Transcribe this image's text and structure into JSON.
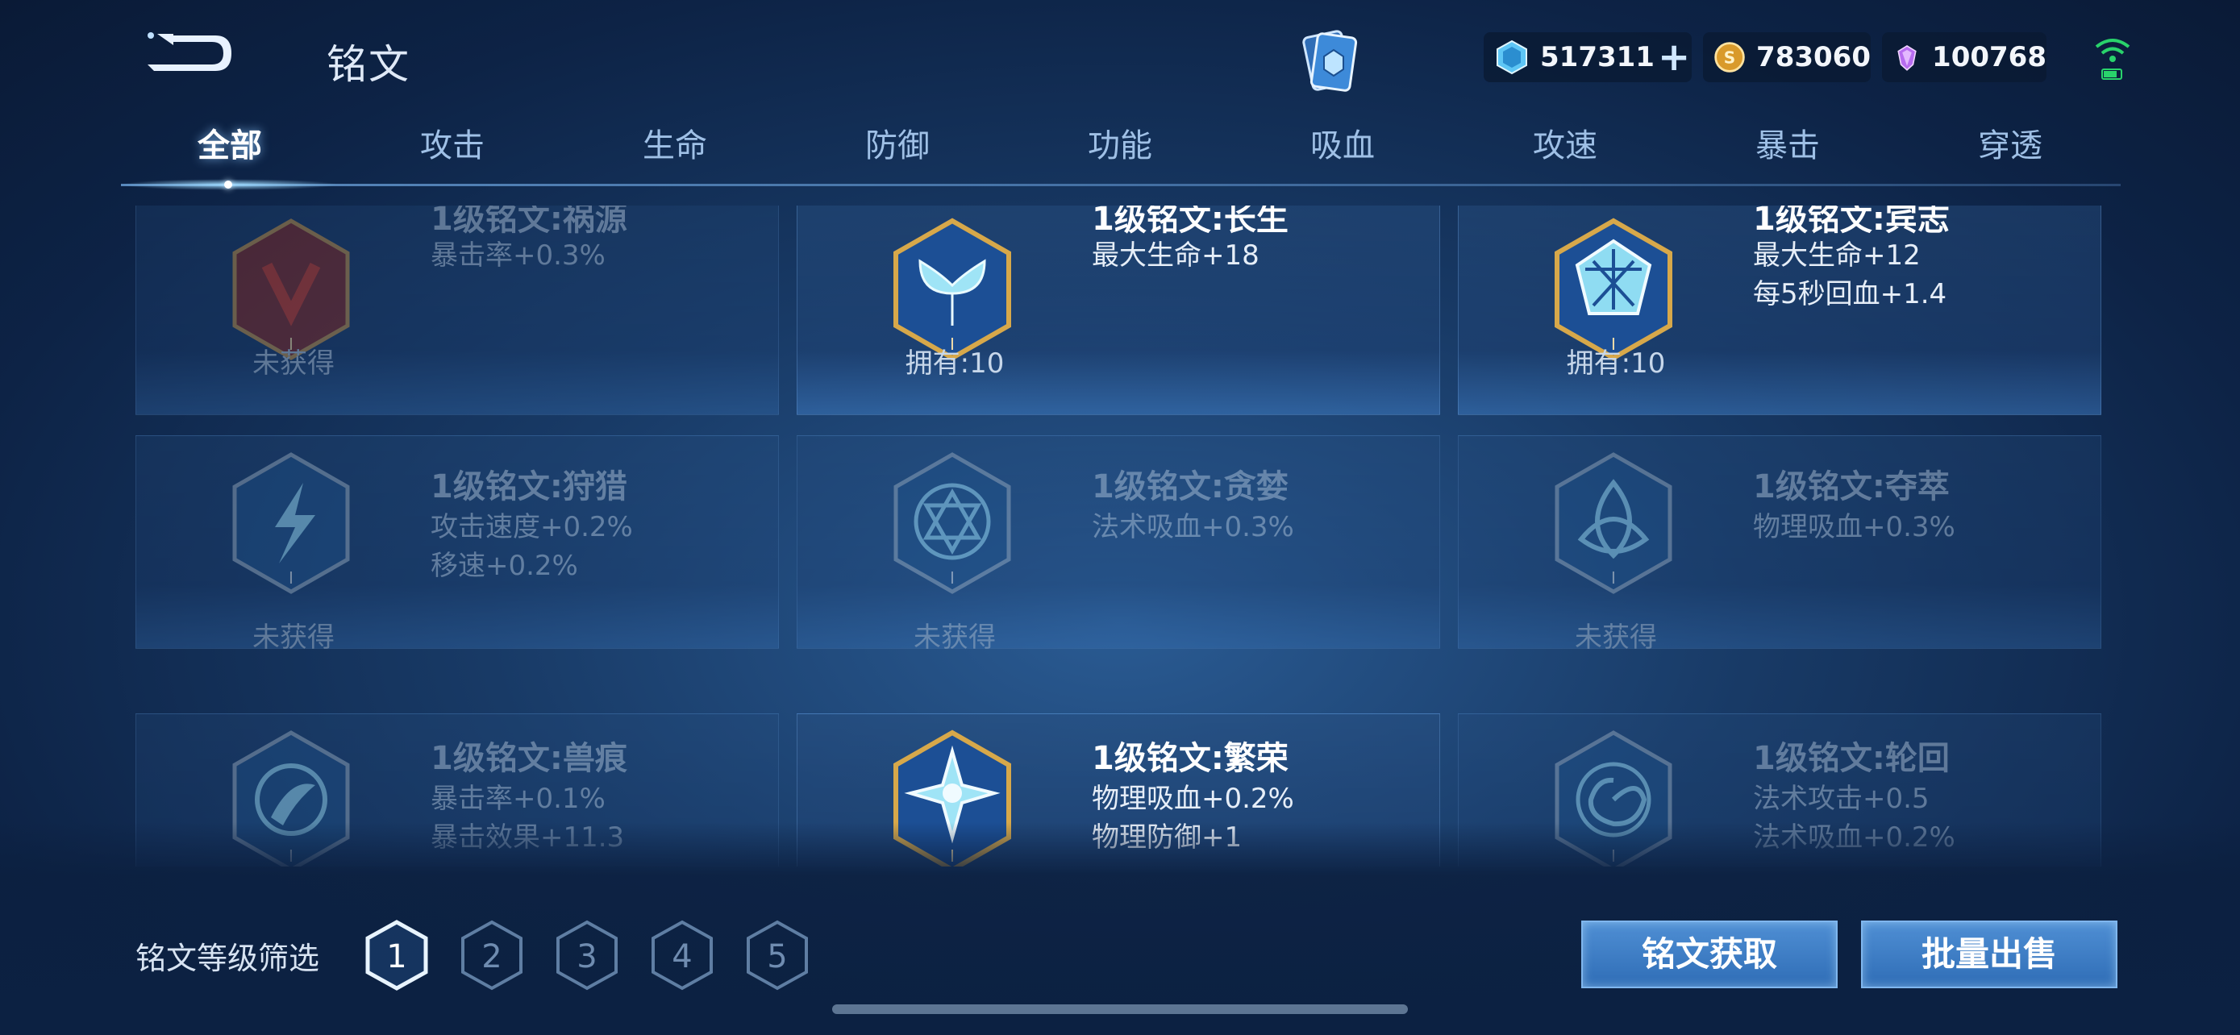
{
  "header": {
    "title": "铭文",
    "currencies": [
      {
        "icon": "diamond-gem-icon",
        "value": "517311"
      },
      {
        "icon": "gold-coin-icon",
        "value": "783060"
      },
      {
        "icon": "purple-crystal-icon",
        "value": "100768"
      }
    ]
  },
  "tabs": [
    "全部",
    "攻击",
    "生命",
    "防御",
    "功能",
    "吸血",
    "攻速",
    "暴击",
    "穿透"
  ],
  "active_tab": "全部",
  "cards": [
    {
      "name": "1级铭文:祸源",
      "lines": [
        "暴击率+0.3%",
        ""
      ],
      "status": "未获得",
      "owned": false,
      "color": "#c0392b",
      "icon": "claw-rune-icon"
    },
    {
      "name": "1级铭文:长生",
      "lines": [
        "最大生命+18",
        ""
      ],
      "status": "拥有:10",
      "owned": true,
      "color": "#3fb7e0",
      "icon": "tail-rune-icon"
    },
    {
      "name": "1级铭文:宾志",
      "lines": [
        "最大生命+12",
        "每5秒回血+1.4"
      ],
      "status": "拥有:10",
      "owned": true,
      "color": "#3fb7e0",
      "icon": "crystal-rune-icon"
    },
    {
      "name": "1级铭文:狩猎",
      "lines": [
        "攻击速度+0.2%",
        "移速+0.2%"
      ],
      "status": "未获得",
      "owned": false,
      "color": "#3a7fc0",
      "icon": "lightning-rune-icon"
    },
    {
      "name": "1级铭文:贪婪",
      "lines": [
        "法术吸血+0.3%",
        ""
      ],
      "status": "未获得",
      "owned": false,
      "color": "#3a7fc0",
      "icon": "star-rune-icon"
    },
    {
      "name": "1级铭文:夺萃",
      "lines": [
        "物理吸血+0.3%",
        ""
      ],
      "status": "未获得",
      "owned": false,
      "color": "#3a7fc0",
      "icon": "knot-rune-icon"
    },
    {
      "name": "1级铭文:兽痕",
      "lines": [
        "暴击率+0.1%",
        "暴击效果+11.3"
      ],
      "status": "",
      "owned": false,
      "color": "#3a7fc0",
      "icon": "beast-rune-icon"
    },
    {
      "name": "1级铭文:繁荣",
      "lines": [
        "物理吸血+0.2%",
        "物理防御+1"
      ],
      "status": "",
      "owned": true,
      "color": "#3fb7e0",
      "icon": "snowflake-rune-icon"
    },
    {
      "name": "1级铭文:轮回",
      "lines": [
        "法术攻击+0.5",
        "法术吸血+0.2%"
      ],
      "status": "",
      "owned": false,
      "color": "#3a7fc0",
      "icon": "spiral-rune-icon"
    }
  ],
  "footer": {
    "filter_label": "铭文等级筛选",
    "levels": [
      "1",
      "2",
      "3",
      "4",
      "5"
    ],
    "selected_level": "1",
    "btn_acquire": "铭文获取",
    "btn_sell": "批量出售"
  }
}
